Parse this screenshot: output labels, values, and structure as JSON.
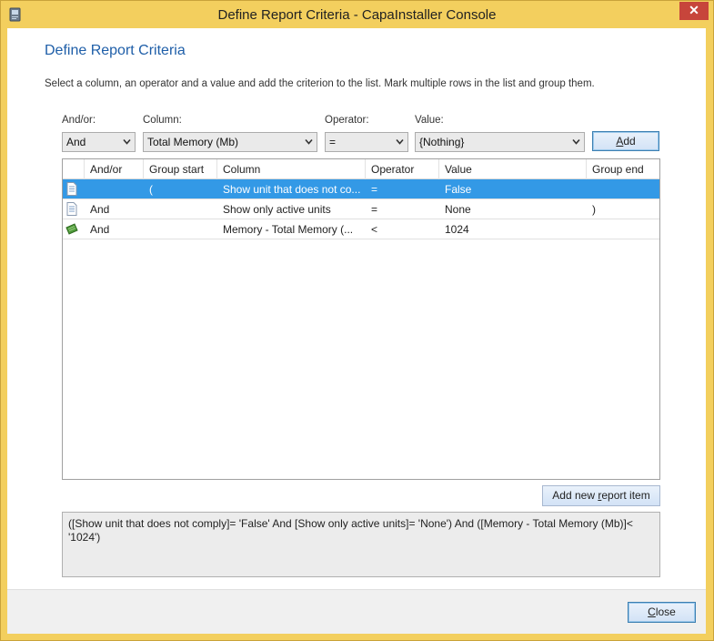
{
  "window": {
    "title": "Define Report Criteria - CapaInstaller Console",
    "close_glyph": "✕"
  },
  "page": {
    "heading": "Define Report Criteria",
    "instructions": "Select a column, an operator and a value and add the criterion to the list. Mark multiple rows in the list and group them."
  },
  "form": {
    "andor_label": "And/or:",
    "column_label": "Column:",
    "operator_label": "Operator:",
    "value_label": "Value:",
    "andor_value": "And",
    "column_value": "Total Memory (Mb)",
    "operator_value": "=",
    "value_value": "{Nothing}",
    "add_button_pre": "",
    "add_button_acc": "A",
    "add_button_post": "dd"
  },
  "grid": {
    "headers": [
      "And/or",
      "Group start",
      "Column",
      "Operator",
      "Value",
      "Group end"
    ],
    "rows": [
      {
        "icon": "document-icon",
        "andor": "",
        "group_start": "(",
        "column": "Show unit that does not co...",
        "operator": "=",
        "value": "False",
        "group_end": "",
        "selected": true
      },
      {
        "icon": "document-icon",
        "andor": "And",
        "group_start": "",
        "column": "Show only active units",
        "operator": "=",
        "value": "None",
        "group_end": ")",
        "selected": false
      },
      {
        "icon": "memory-chip-icon",
        "andor": "And",
        "group_start": "",
        "column": "Memory - Total Memory (...",
        "operator": "<",
        "value": "1024",
        "group_end": "",
        "selected": false
      }
    ]
  },
  "report_button": {
    "pre": "Add new ",
    "acc": "r",
    "post": "eport item"
  },
  "expression": "([Show unit that does not comply]= 'False' And  [Show only active units]= 'None') And  ([Memory - Total Memory (Mb)]< '1024')",
  "footer": {
    "close_pre": "",
    "close_acc": "C",
    "close_post": "lose"
  },
  "colors": {
    "title_bar": "#f3cf5e",
    "heading": "#1e5ea8",
    "selection": "#3399e6"
  }
}
